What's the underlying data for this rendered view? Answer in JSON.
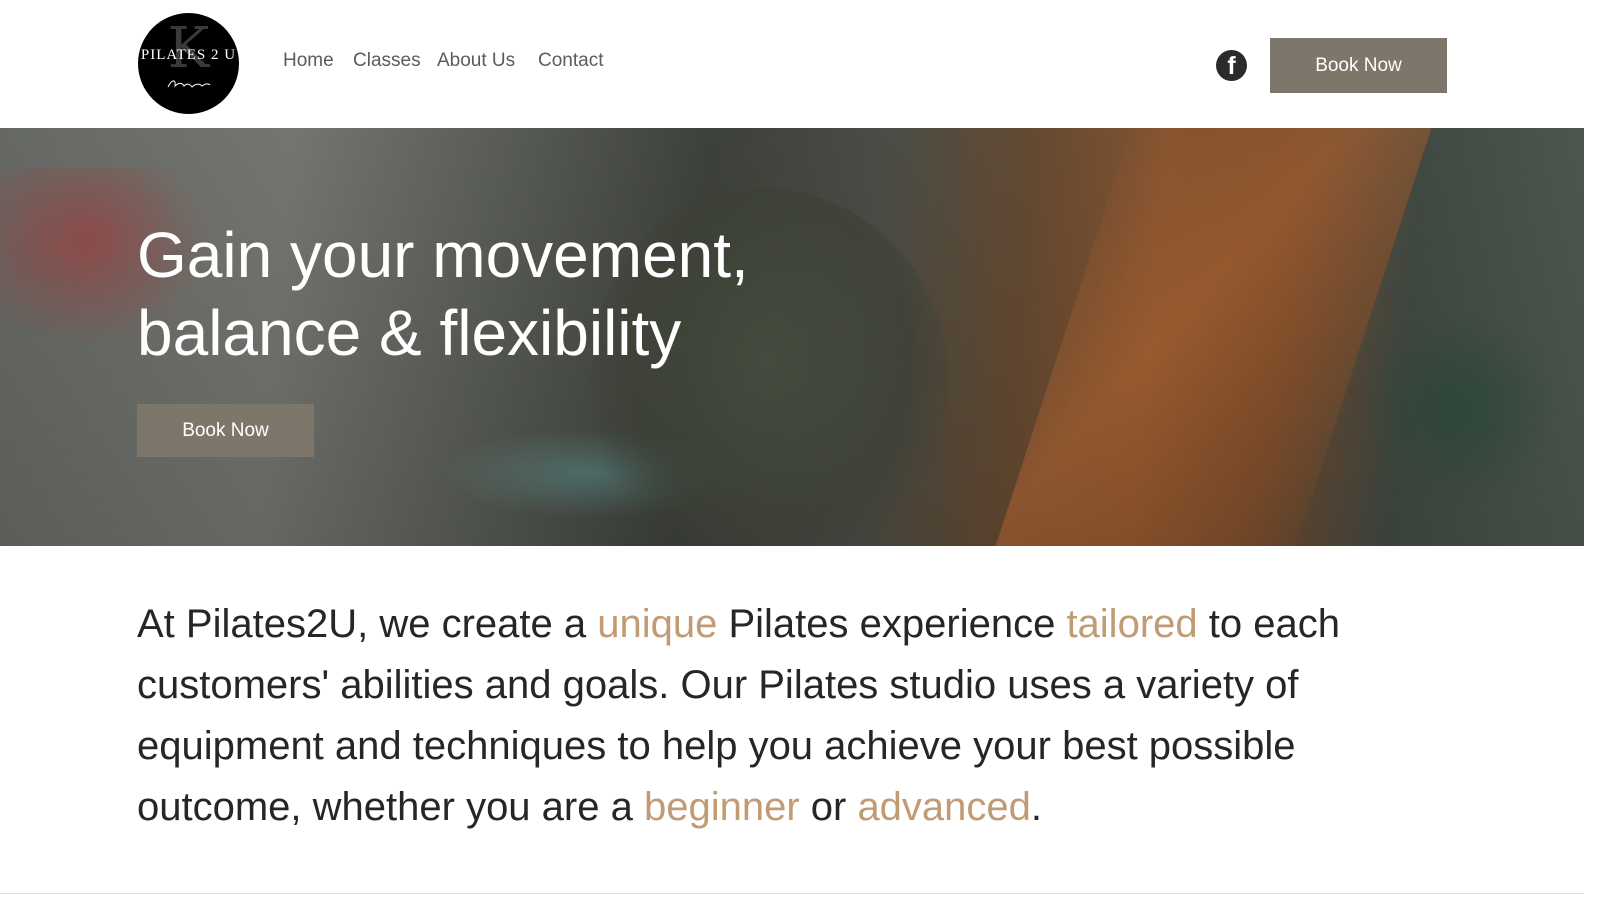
{
  "header": {
    "logo": {
      "letter": "K",
      "text": "PILATES 2 U"
    },
    "nav": [
      {
        "label": "Home"
      },
      {
        "label": "Classes"
      },
      {
        "label": "About Us"
      },
      {
        "label": "Contact"
      }
    ],
    "social_icon": "facebook-icon",
    "book_label": "Book Now"
  },
  "hero": {
    "title_line1": "Gain your movement,",
    "title_line2": "balance & flexibility",
    "book_label": "Book Now"
  },
  "intro": {
    "p1": "At Pilates2U, we create a ",
    "h1": "unique",
    "p2": " Pilates experience ",
    "h2": "tailored",
    "p3": " to each customers' abilities and goals. Our Pilates studio uses a variety of equipment and techniques to help you achieve your best possible outcome, whether you are a ",
    "h3": "beginner",
    "p4": " or ",
    "h4": "advanced",
    "p5": "."
  },
  "colors": {
    "accent": "#c09b73",
    "button": "#7d766b",
    "text": "#262626",
    "nav": "#5c5c5c"
  }
}
